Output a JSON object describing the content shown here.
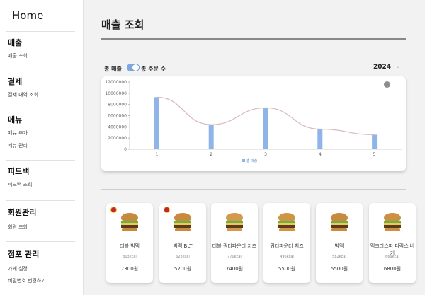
{
  "sidebar": {
    "home": "Home",
    "groups": [
      {
        "title": "매출",
        "items": [
          "매출 조회"
        ]
      },
      {
        "title": "결제",
        "items": [
          "결제 내역 조회"
        ]
      },
      {
        "title": "메뉴",
        "items": [
          "메뉴 추가",
          "메뉴 관리"
        ]
      },
      {
        "title": "피드백",
        "items": [
          "피드백 조회"
        ]
      },
      {
        "title": "회원관리",
        "items": [
          "회원 조회"
        ]
      },
      {
        "title": "점포 관리",
        "items": [
          "가게 설정",
          "비밀번호 변경하기"
        ]
      }
    ]
  },
  "page": {
    "title": "매출 조회"
  },
  "controls": {
    "sales_label": "총 매출",
    "orders_label": "총 주문 수",
    "toggle_on": true,
    "year": "2024"
  },
  "chart_data": {
    "type": "bar",
    "categories": [
      "1",
      "2",
      "3",
      "4",
      "5"
    ],
    "series": [
      {
        "name": "총 매출",
        "values": [
          9300000,
          4400000,
          7400000,
          3600000,
          2600000
        ],
        "color": "#8fb5e8"
      }
    ],
    "trend_line": true,
    "trend_color": "#d9b8bc",
    "ylim": [
      0,
      12000000
    ],
    "yticks": [
      "0",
      "2000000",
      "4000000",
      "6000000",
      "8000000",
      "10000000",
      "12000000"
    ],
    "legend_placement": "bottom"
  },
  "menu": [
    {
      "name": "더블 빅맥",
      "kcal": "803kcal",
      "price": "7300원",
      "badge": true,
      "bun": "#c58a3c"
    },
    {
      "name": "빅맥 BLT",
      "kcal": "628kcal",
      "price": "5200원",
      "badge": true,
      "bun": "#c98a3e"
    },
    {
      "name": "더블 쿼터파운더 치즈",
      "kcal": "770kcal",
      "price": "7400원",
      "badge": false,
      "bun": "#d29a4c"
    },
    {
      "name": "쿼터파운더 치즈",
      "kcal": "496kcal",
      "price": "5500원",
      "badge": false,
      "bun": "#cf9444"
    },
    {
      "name": "빅맥",
      "kcal": "582kcal",
      "price": "5500원",
      "badge": false,
      "bun": "#c88a3f"
    },
    {
      "name": "맥크리스피 디럭스 버거",
      "kcal": "669kcal",
      "price": "6800원",
      "badge": false,
      "bun": "#cc8f43"
    }
  ],
  "colors": {
    "accent": "#8fb5e8",
    "toggle": "#7fa6dd",
    "sidebar_bg": "#ffffff",
    "page_bg": "#f2f2f2"
  }
}
